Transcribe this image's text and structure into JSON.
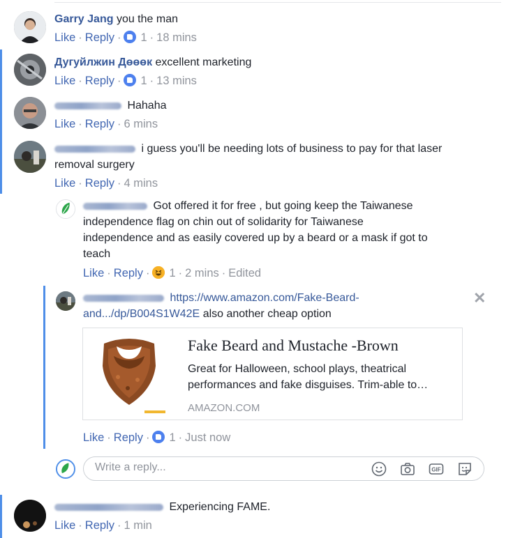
{
  "comments": [
    {
      "name": "Garry Jang",
      "text": "you the man",
      "like": "Like",
      "reply": "Reply",
      "count": "1",
      "time": "18 mins"
    },
    {
      "name": "Дугуйлжин Дөөөк",
      "text": "excellent marketing",
      "like": "Like",
      "reply": "Reply",
      "count": "1",
      "time": "13 mins"
    },
    {
      "text": "Hahaha",
      "like": "Like",
      "reply": "Reply",
      "time": "6 mins"
    },
    {
      "text_line1": "i guess you'll be needing lots of business to pay for that laser",
      "text_line2": "removal surgery",
      "like": "Like",
      "reply": "Reply",
      "time": "4 mins"
    }
  ],
  "replies": [
    {
      "lines": [
        "Got offered it for free , but going keep the Taiwanese",
        "independence flag on chin out of solidarity for Taiwanese",
        "independence and as easily covered up by a beard or a mask if got to",
        "teach"
      ],
      "like": "Like",
      "reply": "Reply",
      "count": "1",
      "time": "2 mins",
      "edited": "Edited",
      "reaction_icon": "haha-icon"
    },
    {
      "link_part1": "https://www.amazon.com/Fake-Beard-",
      "link_part2": "and.../dp/B004S1W42E",
      "text": "also another cheap option",
      "like": "Like",
      "reply": "Reply",
      "count": "1",
      "time": "Just now"
    }
  ],
  "link_card": {
    "title": "Fake Beard and Mustache -Brown",
    "desc_line1": "Great for Halloween, school plays, theatrical",
    "desc_line2": "performances and fake disguises. Trim-able to…",
    "source": "AMAZON.COM"
  },
  "reply_box": {
    "placeholder": "Write a reply..."
  },
  "last_comment": {
    "text": "Experiencing FAME.",
    "like": "Like",
    "reply": "Reply",
    "time": "1 min"
  },
  "close_symbol": "✕",
  "colors": {
    "name": "#365899",
    "action_link": "#4267b2",
    "meta": "#90949c",
    "thread_bar": "#4e8ee8",
    "like_blue": "#4d80ee",
    "haha_yellow": "#f7b125"
  }
}
